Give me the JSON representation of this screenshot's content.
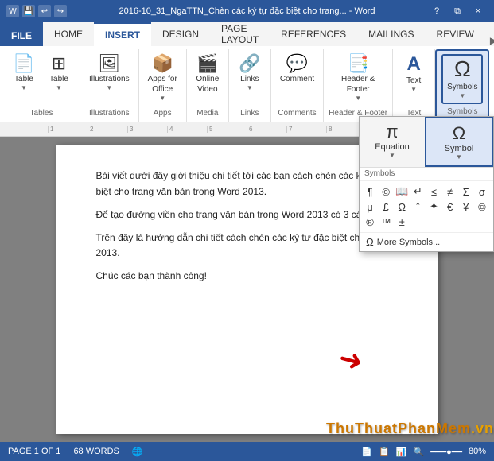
{
  "titleBar": {
    "title": "2016-10_31_NgaTTN_Chèn các ký tự đặc biệt cho trang... - Word",
    "helpIcon": "?",
    "restoreIcon": "⧉",
    "closeIcon": "×",
    "undoIcon": "↩",
    "redoIcon": "↪",
    "saveIcon": "💾"
  },
  "tabs": {
    "file": "FILE",
    "items": [
      "HOME",
      "INSERT",
      "DESIGN",
      "PAGE LAYOUT",
      "REFERENCES",
      "MAILINGS",
      "REVIEW"
    ]
  },
  "activeTab": "INSERT",
  "ribbon": {
    "groups": [
      {
        "name": "Tables",
        "label": "Tables",
        "buttons": [
          {
            "id": "table-btn",
            "icon": "⊞",
            "label": "Table",
            "hasArrow": true
          }
        ]
      },
      {
        "name": "Illustrations",
        "label": "Illustrations",
        "buttons": [
          {
            "id": "illustrations-btn",
            "icon": "🖼",
            "label": "Illustrations",
            "hasArrow": true
          }
        ]
      },
      {
        "name": "Apps",
        "label": "Apps",
        "buttons": [
          {
            "id": "apps-btn",
            "icon": "📦",
            "label": "Apps for Office",
            "hasArrow": true
          }
        ]
      },
      {
        "name": "Media",
        "label": "Media",
        "buttons": [
          {
            "id": "media-btn",
            "icon": "🎬",
            "label": "Online Video",
            "hasArrow": false
          }
        ]
      },
      {
        "name": "Links",
        "label": "Links",
        "buttons": [
          {
            "id": "links-btn",
            "icon": "🔗",
            "label": "Links",
            "hasArrow": true
          }
        ]
      },
      {
        "name": "Comments",
        "label": "Comments",
        "buttons": [
          {
            "id": "comment-btn",
            "icon": "💬",
            "label": "Comment",
            "hasArrow": false
          }
        ]
      },
      {
        "name": "HeaderFooter",
        "label": "Header & Footer",
        "buttons": [
          {
            "id": "headerfooter-btn",
            "icon": "📄",
            "label": "Header & Footer",
            "hasArrow": true
          }
        ]
      },
      {
        "name": "Text",
        "label": "Text",
        "buttons": [
          {
            "id": "text-btn",
            "icon": "A",
            "label": "Text",
            "hasArrow": true
          }
        ]
      },
      {
        "name": "Symbols",
        "label": "Symbols",
        "buttons": [
          {
            "id": "symbols-btn",
            "icon": "Ω",
            "label": "Symbols",
            "hasArrow": true,
            "active": true
          }
        ]
      }
    ]
  },
  "symbolsPopup": {
    "equationLabel": "Equation",
    "equationIcon": "π",
    "symbolLabel": "Symbol",
    "symbolIcon": "Ω",
    "sectionLabel": "Symbols",
    "symbols": [
      "¶",
      "©",
      "📖",
      "↵",
      "≤",
      "≠",
      "Σ",
      "σ",
      "μ",
      "£",
      "Ω",
      "ˆ",
      "*",
      "€",
      "¥",
      "©",
      "®",
      "™",
      "±",
      "→"
    ],
    "moreLabel": "More Symbols..."
  },
  "document": {
    "paragraph1": "Bài viết dưới đây giới thiệu chi tiết tới các bạn cách chèn các ký tự đặc biệt cho trang văn bản trong Word 2013.",
    "paragraph2": "Để tạo đường viền cho trang văn bản trong Word 2013 có 3 cách sau:",
    "paragraph3": "Trên đây là hướng dẫn chi tiết cách chèn các ký tự đặc biệt cho Word 2013.",
    "paragraph4": "Chúc các bạn thành công!"
  },
  "statusBar": {
    "page": "PAGE 1 OF 1",
    "words": "68 WORDS",
    "zoom": "80%"
  },
  "watermark": "ThuThuatPhanMem",
  "watermarkDomain": ".vn"
}
